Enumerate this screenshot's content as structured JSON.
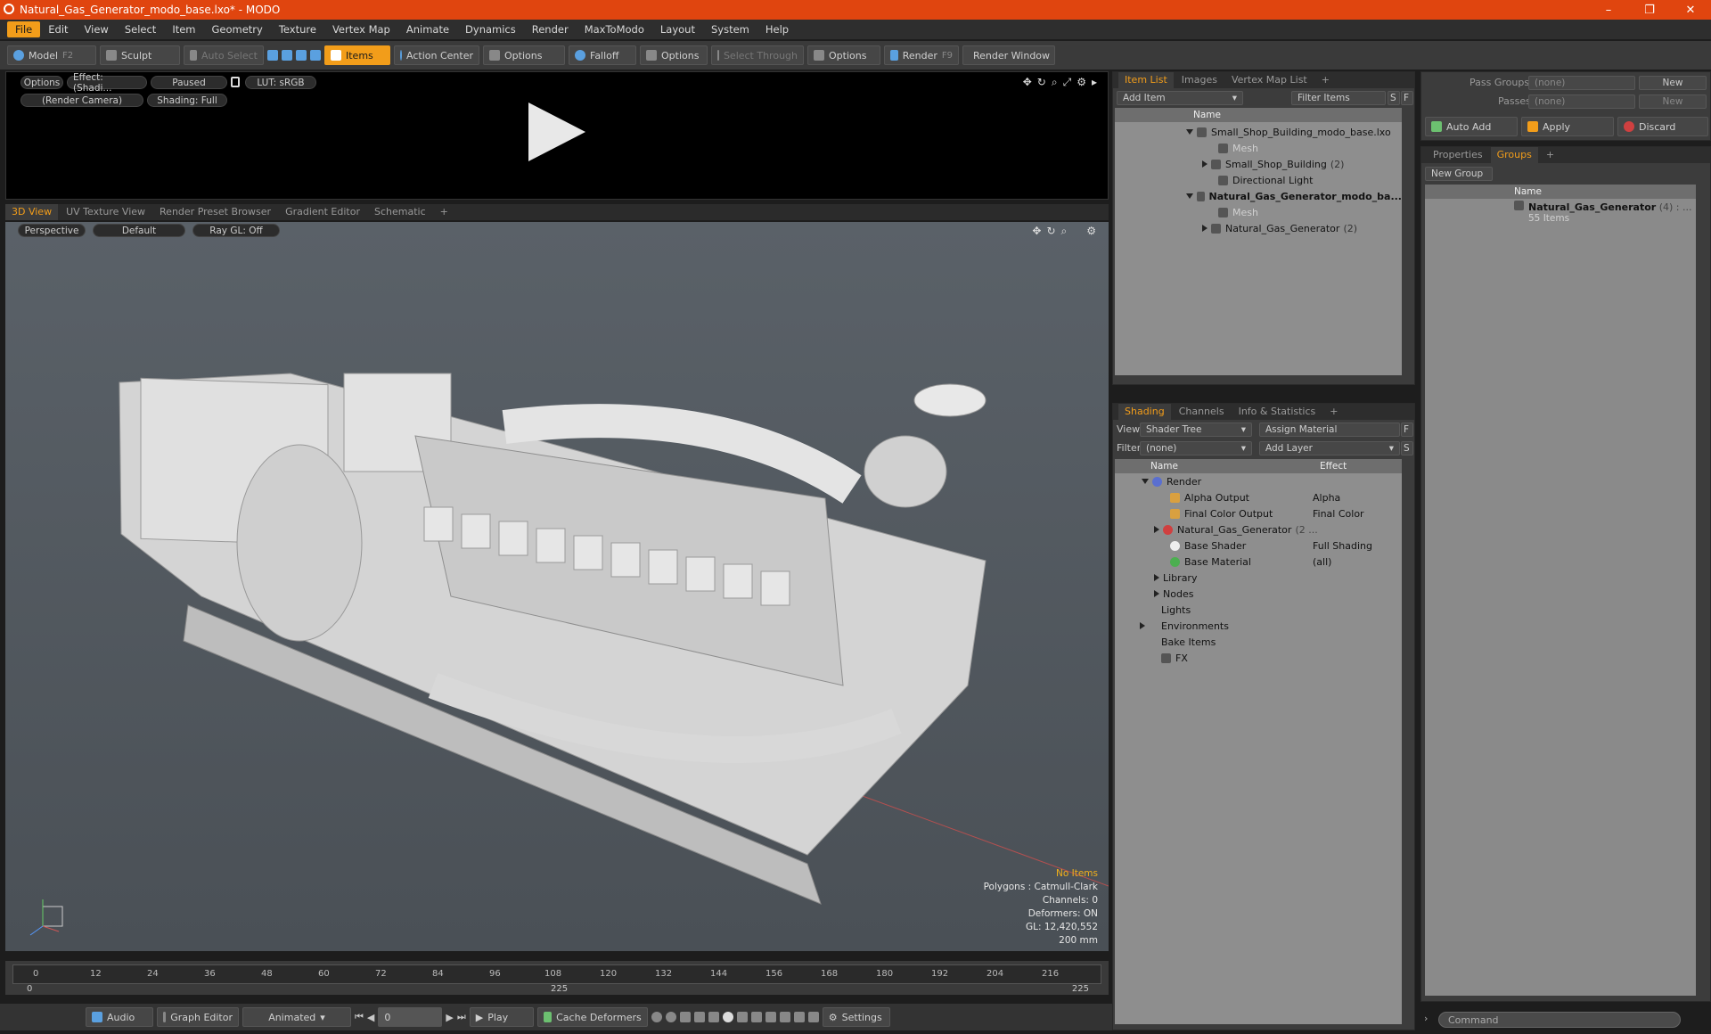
{
  "window": {
    "title": "Natural_Gas_Generator_modo_base.lxo* - MODO",
    "min": "–",
    "max": "❐",
    "close": "✕"
  },
  "menu": [
    "File",
    "Edit",
    "View",
    "Select",
    "Item",
    "Geometry",
    "Texture",
    "Vertex Map",
    "Animate",
    "Dynamics",
    "Render",
    "MaxToModo",
    "Layout",
    "System",
    "Help"
  ],
  "toolbar": {
    "model": "Model",
    "model_key": "F2",
    "sculpt": "Sculpt",
    "auto_select": "Auto Select",
    "items": "Items",
    "action_center": "Action Center",
    "options1": "Options",
    "falloff": "Falloff",
    "options2": "Options",
    "select_through": "Select Through",
    "options3": "Options",
    "render": "Render",
    "render_key": "F9",
    "render_window": "Render Window"
  },
  "preview": {
    "options": "Options",
    "effect": "Effect: (Shadi...",
    "paused": "Paused",
    "lut": "LUT: sRGB",
    "camera": "(Render Camera)",
    "shading": "Shading: Full"
  },
  "viewtabs": [
    "3D View",
    "UV Texture View",
    "Render Preset Browser",
    "Gradient Editor",
    "Schematic",
    "+"
  ],
  "viewport": {
    "perspective": "Perspective",
    "default": "Default",
    "raygl": "Ray GL: Off",
    "stats": {
      "noitems": "No Items",
      "polygons": "Polygons : Catmull-Clark",
      "channels": "Channels: 0",
      "deformers": "Deformers: ON",
      "gl": "GL: 12,420,552",
      "scale": "200 mm"
    }
  },
  "timeline": {
    "ticks": [
      "0",
      "12",
      "24",
      "36",
      "48",
      "60",
      "72",
      "84",
      "96",
      "108",
      "120",
      "132",
      "144",
      "156",
      "168",
      "180",
      "192",
      "204",
      "216"
    ],
    "range_start": "0",
    "range_mid": "225",
    "range_end": "225"
  },
  "bottom": {
    "audio": "Audio",
    "graph_editor": "Graph Editor",
    "animated": "Animated",
    "frame": "0",
    "play": "Play",
    "cache": "Cache Deformers",
    "settings": "Settings"
  },
  "itemlist": {
    "tabs": [
      "Item List",
      "Images",
      "Vertex Map List",
      "+"
    ],
    "add_item": "Add Item",
    "filter": "Filter Items",
    "s": "S",
    "f": "F",
    "col_name": "Name",
    "rows": [
      {
        "label": "Small_Shop_Building_modo_base.lxo"
      },
      {
        "label": "Mesh"
      },
      {
        "label": "Small_Shop_Building",
        "count": "(2)"
      },
      {
        "label": "Directional Light"
      },
      {
        "label": "Natural_Gas_Generator_modo_ba..."
      },
      {
        "label": "Mesh"
      },
      {
        "label": "Natural_Gas_Generator",
        "count": "(2)"
      }
    ]
  },
  "shading": {
    "tabs": [
      "Shading",
      "Channels",
      "Info & Statistics",
      "+"
    ],
    "view_label": "View",
    "view_value": "Shader Tree",
    "assign": "Assign Material",
    "f": "F",
    "filter_label": "Filter",
    "filter_value": "(none)",
    "add_layer": "Add Layer",
    "s": "S",
    "col_name": "Name",
    "col_effect": "Effect",
    "rows": [
      {
        "label": "Render",
        "effect": ""
      },
      {
        "label": "Alpha Output",
        "effect": "Alpha"
      },
      {
        "label": "Final Color Output",
        "effect": "Final Color"
      },
      {
        "label": "Natural_Gas_Generator",
        "extra": "(2 ...",
        "effect": ""
      },
      {
        "label": "Base Shader",
        "effect": "Full Shading"
      },
      {
        "label": "Base Material",
        "effect": "(all)"
      },
      {
        "label": "Library",
        "effect": ""
      },
      {
        "label": "Nodes",
        "effect": ""
      },
      {
        "label": "Lights",
        "effect": ""
      },
      {
        "label": "Environments",
        "effect": ""
      },
      {
        "label": "Bake Items",
        "effect": ""
      },
      {
        "label": "FX",
        "effect": ""
      }
    ]
  },
  "passgroups": {
    "pass_groups": "Pass Groups",
    "none1": "(none)",
    "new1": "New",
    "passes": "Passes",
    "none2": "(none)",
    "new2": "New",
    "auto_add": "Auto Add",
    "apply": "Apply",
    "discard": "Discard"
  },
  "groups": {
    "tabs": [
      "Properties",
      "Groups",
      "+"
    ],
    "new_group": "New Group",
    "col_name": "Name",
    "item": "Natural_Gas_Generator",
    "item_count": "(4) : ...",
    "sub": "55 Items"
  },
  "command": {
    "placeholder": "Command"
  }
}
